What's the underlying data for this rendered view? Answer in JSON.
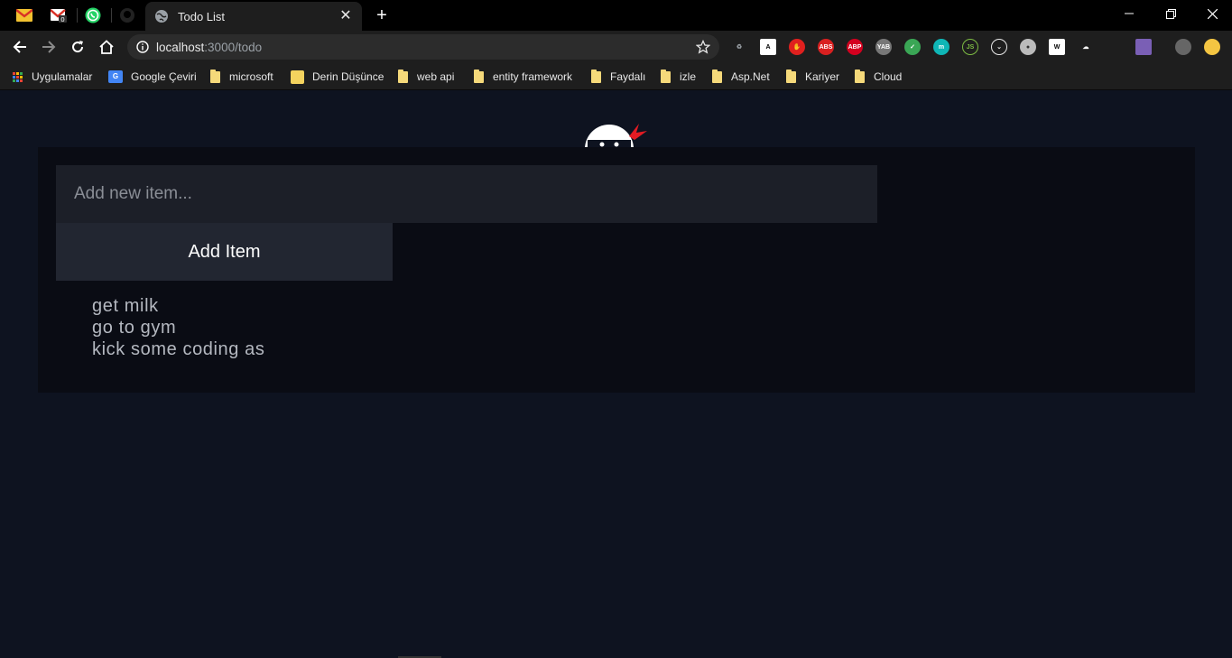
{
  "browser": {
    "active_tab_title": "Todo List",
    "url_host": "localhost",
    "url_rest": ":3000/todo",
    "pinned_tabs": [
      {
        "icon": "gmail-icon"
      },
      {
        "icon": "gmail-notification-icon"
      },
      {
        "icon": "whatsapp-icon"
      },
      {
        "icon": "github-icon"
      }
    ],
    "extensions": [
      {
        "icon": "recycle-icon"
      },
      {
        "icon": "font-a-icon"
      },
      {
        "icon": "stop-hand-icon"
      },
      {
        "icon": "adblock-icon",
        "label": "ABS"
      },
      {
        "icon": "abp-icon",
        "label": "ABP"
      },
      {
        "icon": "yab-icon",
        "label": "YAB"
      },
      {
        "icon": "shield-icon"
      },
      {
        "icon": "m-icon",
        "label": "m"
      },
      {
        "icon": "nodejs-icon",
        "label": "JS"
      },
      {
        "icon": "pocket-icon"
      },
      {
        "icon": "record-icon"
      },
      {
        "icon": "wikipedia-icon",
        "label": "W"
      },
      {
        "icon": "cloud-icon"
      },
      {
        "icon": "pdf-icon"
      },
      {
        "icon": "profile-avatar-icon"
      },
      {
        "icon": "coin-icon"
      }
    ],
    "bookmarks": [
      {
        "label": "Uygulamalar",
        "icon": "apps-grid-icon"
      },
      {
        "label": "Google Çeviri",
        "icon": "google-translate-icon"
      },
      {
        "label": "microsoft",
        "icon": "folder-icon"
      },
      {
        "label": "Derin Düşünce",
        "icon": "derin-icon"
      },
      {
        "label": "web api",
        "icon": "folder-icon"
      },
      {
        "label": "entity framework",
        "icon": "folder-icon"
      },
      {
        "label": "Faydalı",
        "icon": "folder-icon"
      },
      {
        "label": "izle",
        "icon": "folder-icon"
      },
      {
        "label": "Asp.Net",
        "icon": "folder-icon"
      },
      {
        "label": "Kariyer",
        "icon": "folder-icon"
      },
      {
        "label": "Cloud",
        "icon": "folder-icon"
      }
    ]
  },
  "todo": {
    "input_placeholder": "Add new item...",
    "input_value": "",
    "add_button_label": "Add Item",
    "items": [
      "get milk",
      "go to gym",
      "kick some coding as"
    ]
  },
  "colors": {
    "page_bg": "#0e1320",
    "card_bg": "#0a0c14",
    "input_bg": "#1c1f28",
    "button_bg": "#222631",
    "item_text": "#b4b8c0",
    "logo_accent": "#e21b23"
  }
}
